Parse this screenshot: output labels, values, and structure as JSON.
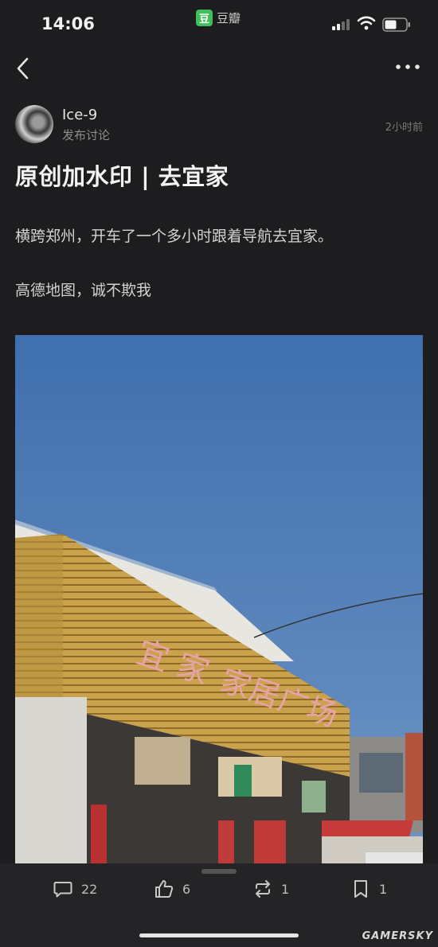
{
  "status_bar": {
    "time": "14:06",
    "app_name": "豆瓣",
    "app_logo_char": "豆"
  },
  "post": {
    "author": "Ice-9",
    "action": "发布讨论",
    "time_ago": "2小时前",
    "title": "原创加水印 | 去宜家",
    "paragraphs": [
      "横跨郑州，开车了一个多小时跟着导航去宜家。",
      "高德地图，诚不欺我"
    ]
  },
  "actions": {
    "comments": "22",
    "likes": "6",
    "reposts": "1",
    "bookmarks": "1"
  },
  "watermark": "GAMERSKY",
  "colors": {
    "background": "#1d1d1f",
    "bottom_bar": "#242426",
    "brand_green": "#3fbf5a"
  }
}
